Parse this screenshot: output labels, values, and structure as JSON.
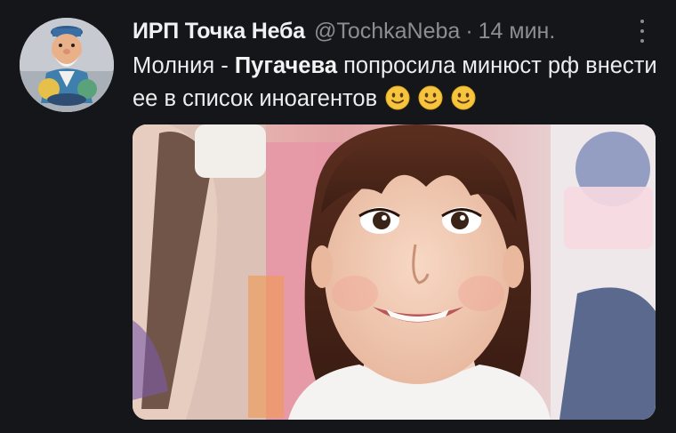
{
  "tweet": {
    "display_name": "ИРП Точка Неба",
    "handle": "@TochkaNeba",
    "separator": "·",
    "time": "14 мин.",
    "text_prefix": "Молния - ",
    "text_bold": "Пугачева",
    "text_rest": " попросила минюст рф внести ее в список иноагентов",
    "emoji_count": 3,
    "emoji_name": "slightly-smiling-face-icon"
  },
  "colors": {
    "background": "#15161a",
    "secondary_text": "#8a8d91",
    "primary_text": "#eceded"
  }
}
